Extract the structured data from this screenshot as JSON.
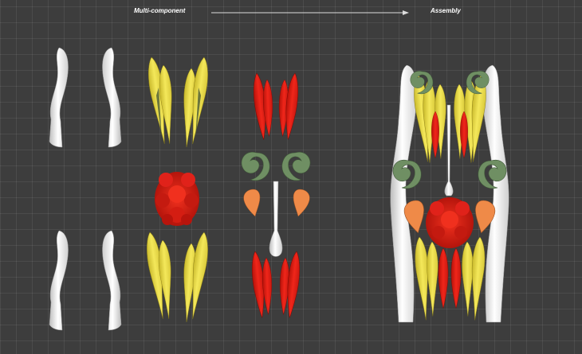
{
  "header": {
    "left_label": "Multi-component",
    "right_label": "Assembly",
    "arrow": "right-arrow-icon"
  },
  "colors": {
    "background": "#3d3d3d",
    "white_part": "#efefef",
    "yellow_part": "#efe24a",
    "red_part": "#e81d12",
    "green_part": "#6f8f63",
    "orange_part": "#ef8a48"
  },
  "components": [
    {
      "name": "white-shell",
      "count": 4
    },
    {
      "name": "yellow-petal",
      "count": 8
    },
    {
      "name": "red-core",
      "count": 1
    },
    {
      "name": "red-sepal",
      "count": 4
    },
    {
      "name": "green-curl",
      "count": 2
    },
    {
      "name": "orange-ear",
      "count": 2
    },
    {
      "name": "white-pistil",
      "count": 1
    }
  ]
}
